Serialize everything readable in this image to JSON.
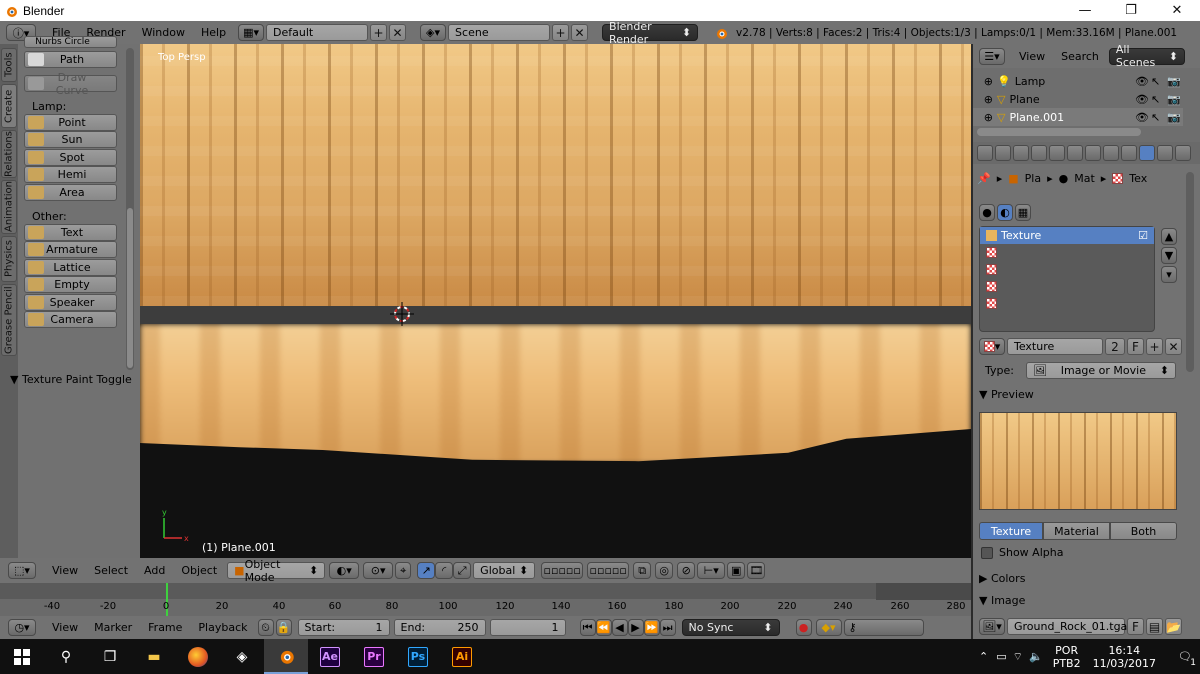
{
  "window": {
    "title": "Blender",
    "controls": [
      "—",
      "❐",
      "✕"
    ]
  },
  "info_header": {
    "menus": [
      "File",
      "Render",
      "Window",
      "Help"
    ],
    "screen_layout": "Default",
    "scene": "Scene",
    "engine": "Blender Render",
    "stats": "v2.78 | Verts:8 | Faces:2 | Tris:4 | Objects:1/3 | Lamps:0/1 | Mem:33.16M | Plane.001"
  },
  "shelf": {
    "tabs": [
      "Tools",
      "Create",
      "Relations",
      "Animation",
      "Physics",
      "Grease Pencil"
    ],
    "active_tab": "Create",
    "partial_top": "Nurbs Circle",
    "path_button": "Path",
    "draw_curve": "Draw Curve",
    "lamp_label": "Lamp:",
    "lamps": [
      "Point",
      "Sun",
      "Spot",
      "Hemi",
      "Area"
    ],
    "other_label": "Other:",
    "others": [
      "Text",
      "Armature",
      "Lattice",
      "Empty",
      "Speaker",
      "Camera"
    ],
    "panel_title": "Texture Paint Toggle"
  },
  "viewport": {
    "view_label": "Top Persp",
    "object_label": "(1) Plane.001"
  },
  "view3d_header": {
    "menus": [
      "View",
      "Select",
      "Add",
      "Object"
    ],
    "mode": "Object Mode",
    "orientation": "Global"
  },
  "timeline": {
    "ticks": [
      "-40",
      "-20",
      "0",
      "20",
      "40",
      "60",
      "80",
      "100",
      "120",
      "140",
      "160",
      "180",
      "200",
      "220",
      "240",
      "260",
      "280"
    ],
    "current_frame": 1
  },
  "timeline_header": {
    "menus": [
      "View",
      "Marker",
      "Frame",
      "Playback"
    ],
    "start_label": "Start:",
    "start_value": "1",
    "end_label": "End:",
    "end_value": "250",
    "current_value": "1",
    "sync": "No Sync"
  },
  "outliner": {
    "menus": [
      "View",
      "Search"
    ],
    "filter": "All Scenes",
    "items": [
      "Lamp",
      "Plane",
      "Plane.001"
    ],
    "selected": "Plane.001"
  },
  "properties": {
    "breadcrumbs": [
      "Pla",
      "Mat",
      "Tex"
    ],
    "texture_slots": [
      "Texture",
      "",
      "",
      "",
      ""
    ],
    "texture_name": "Texture",
    "users": "2",
    "fake_user": "F",
    "type_label": "Type:",
    "type_value": "Image or Movie",
    "preview_title": "Preview",
    "preview_tabs": [
      "Texture",
      "Material",
      "Both"
    ],
    "active_preview_tab": "Texture",
    "show_alpha": "Show Alpha",
    "colors_title": "Colors",
    "image_title": "Image",
    "image_name": "Ground_Rock_01.tga",
    "image_fake_user": "F"
  },
  "taskbar": {
    "apps": [
      "Ae",
      "Pr",
      "Ps",
      "Ai"
    ],
    "app_colors": [
      "#d291ff",
      "#ea77ff",
      "#31a8ff",
      "#ff9a00"
    ],
    "lang_top": "POR",
    "lang_bottom": "PTB2",
    "time": "16:14",
    "date": "11/03/2017",
    "notifications": "1"
  }
}
